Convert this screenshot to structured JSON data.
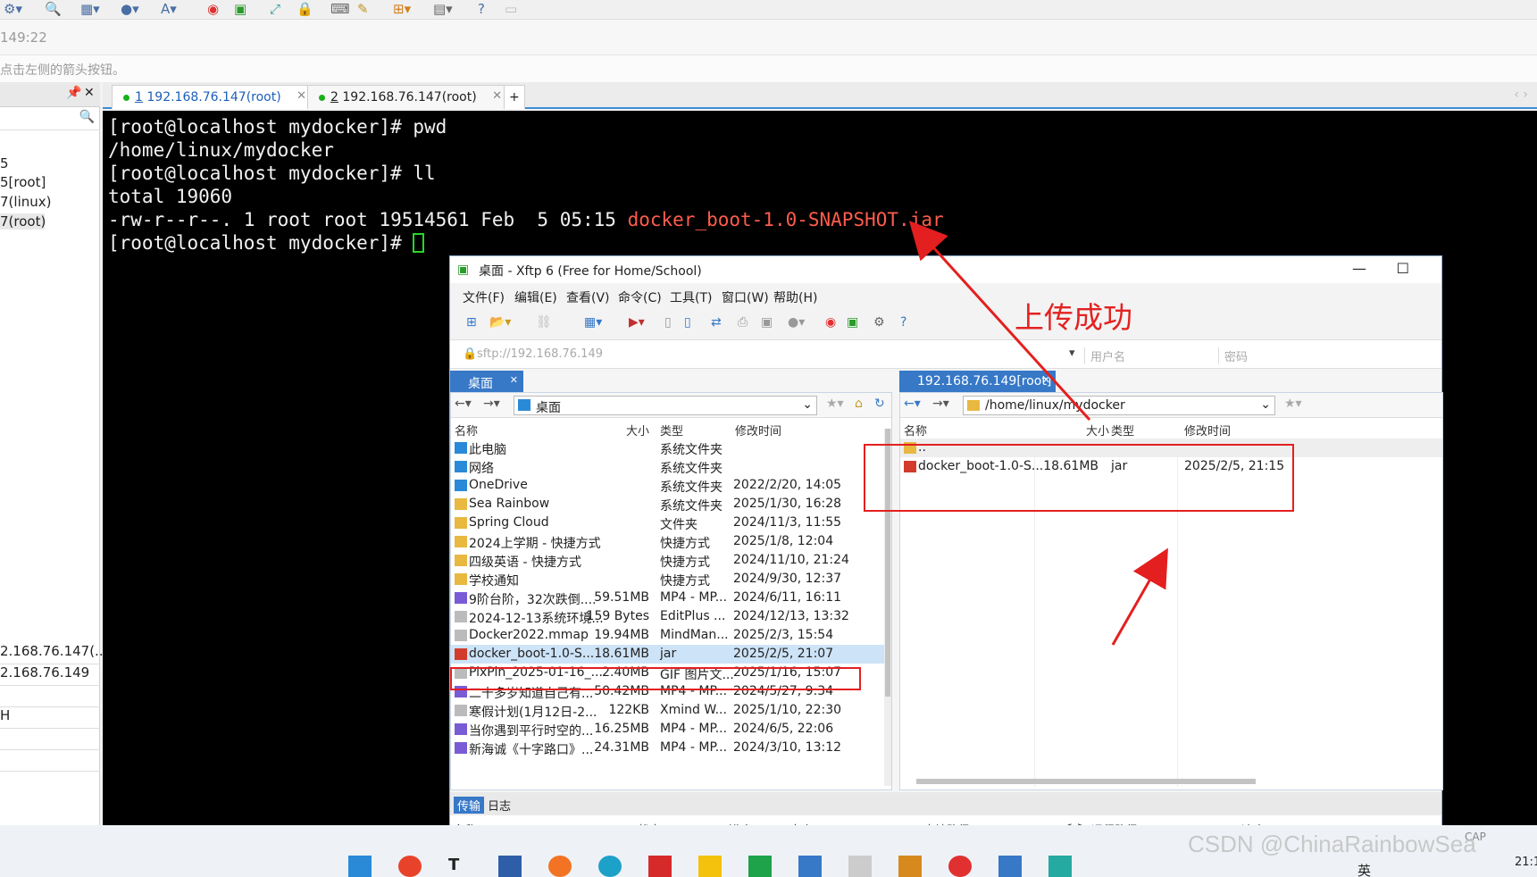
{
  "toolbar": {
    "icons": [
      "new-session-icon",
      "search-icon",
      "layout-icon",
      "globe-icon",
      "font-icon",
      "xshell-icon",
      "xftp-icon",
      "fullscreen-icon",
      "lock-icon",
      "keyboard-icon",
      "script-icon",
      "add-icon",
      "window-icon",
      "help-icon",
      "chat-icon"
    ]
  },
  "timestamp": "149:22",
  "hint": "点击左侧的箭头按钮。",
  "left": {
    "items": [
      "5",
      "5[root]",
      "7(linux)",
      "7(root)"
    ],
    "bottom": [
      "2.168.76.147(...",
      "2.168.76.149",
      "",
      "H"
    ]
  },
  "terminal_tabs": [
    {
      "num": "1",
      "label": "192.168.76.147(root)"
    },
    {
      "num": "2",
      "label": "192.168.76.147(root)"
    }
  ],
  "terminal": {
    "lines": [
      "[root@localhost mydocker]# pwd",
      "/home/linux/mydocker",
      "[root@localhost mydocker]# ll",
      "total 19060",
      "-rw-r--r--. 1 root root 19514561 Feb  5 05:15 "
    ],
    "jar": "docker_boot-1.0-SNAPSHOT.jar",
    "prompt": "[root@localhost mydocker]# "
  },
  "xftp": {
    "title": "桌面 - Xftp 6 (Free for Home/School)",
    "menu": [
      "文件(F)",
      "编辑(E)",
      "查看(V)",
      "命令(C)",
      "工具(T)",
      "窗口(W)",
      "帮助(H)"
    ],
    "address": "sftp://192.168.76.149",
    "user_placeholder": "用户名",
    "pass_placeholder": "密码",
    "local": {
      "tab": "桌面",
      "path": "桌面",
      "headers": [
        "名称",
        "大小",
        "类型",
        "修改时间"
      ],
      "rows": [
        [
          "此电脑",
          "",
          "系统文件夹",
          ""
        ],
        [
          "网络",
          "",
          "系统文件夹",
          ""
        ],
        [
          "OneDrive",
          "",
          "系统文件夹",
          "2022/2/20, 14:05"
        ],
        [
          "Sea Rainbow",
          "",
          "系统文件夹",
          "2025/1/30, 16:28"
        ],
        [
          "Spring Cloud",
          "",
          "文件夹",
          "2024/11/3, 11:55"
        ],
        [
          "2024上学期 - 快捷方式",
          "",
          "快捷方式",
          "2025/1/8, 12:04"
        ],
        [
          "四级英语 - 快捷方式",
          "",
          "快捷方式",
          "2024/11/10, 21:24"
        ],
        [
          "学校通知",
          "",
          "快捷方式",
          "2024/9/30, 12:37"
        ],
        [
          "9阶台阶，32次跌倒....",
          "59.51MB",
          "MP4 - MP...",
          "2024/6/11, 16:11"
        ],
        [
          "2024-12-13系统环境...",
          "159 Bytes",
          "EditPlus ...",
          "2024/12/13, 13:32"
        ],
        [
          "Docker2022.mmap",
          "19.94MB",
          "MindMan...",
          "2025/2/3, 15:54"
        ],
        [
          "docker_boot-1.0-S...",
          "18.61MB",
          "jar",
          "2025/2/5, 21:07"
        ],
        [
          "PixPin_2025-01-16_...",
          "2.40MB",
          "GIF 图片文...",
          "2025/1/16, 15:07"
        ],
        [
          "二十多岁知道自己有...",
          "50.42MB",
          "MP4 - MP...",
          "2024/5/27, 9:34"
        ],
        [
          "寒假计划(1月12日-2...",
          "122KB",
          "Xmind W...",
          "2025/1/10, 22:30"
        ],
        [
          "当你遇到平行时空的...",
          "16.25MB",
          "MP4 - MP...",
          "2024/6/5, 22:06"
        ],
        [
          "新海诚《十字路口》...",
          "24.31MB",
          "MP4 - MP...",
          "2024/3/10, 13:12"
        ]
      ]
    },
    "remote": {
      "tab": "192.168.76.149[root]",
      "path": "/home/linux/mydocker",
      "headers": [
        "名称",
        "大小",
        "类型",
        "修改时间"
      ],
      "rows": [
        [
          "..",
          "",
          "",
          ""
        ],
        [
          "docker_boot-1.0-S...",
          "18.61MB",
          "jar",
          "2025/2/5, 21:15"
        ]
      ]
    },
    "log_tabs": [
      "传输",
      "日志"
    ],
    "transfer_headers": [
      "名称",
      "状态",
      "进度",
      "大小",
      "本地路径",
      "<->",
      "远程路径",
      "速度"
    ]
  },
  "annotation": "上传成功",
  "watermark": "CSDN @ChinaRainbowSea",
  "status": {
    "cap": "CAP",
    "lang": "英",
    "time": "21:1"
  },
  "colors": {
    "accent": "#3778c7",
    "annotation": "#e41f1f",
    "jar": "#ff5c4d"
  }
}
